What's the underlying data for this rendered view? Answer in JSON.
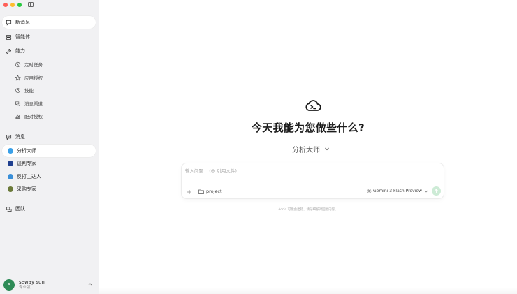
{
  "sidebar": {
    "items": [
      {
        "label": "新消息",
        "icon": "chat-bubble-icon"
      },
      {
        "label": "智能体",
        "icon": "agent-icon"
      },
      {
        "label": "能力",
        "icon": "wrench-icon"
      },
      {
        "label": "定时任务",
        "icon": "clock-icon"
      },
      {
        "label": "应用授权",
        "icon": "star-icon"
      },
      {
        "label": "技能",
        "icon": "skill-icon"
      },
      {
        "label": "消息渠道",
        "icon": "channel-icon"
      },
      {
        "label": "配对授权",
        "icon": "pairing-icon"
      },
      {
        "label": "消息",
        "icon": "message-icon"
      },
      {
        "label": "团队",
        "icon": "team-icon"
      }
    ],
    "agents": [
      {
        "label": "分析大师",
        "color": "#3aa0e8"
      },
      {
        "label": "谈判专家",
        "color": "#1f3f8f"
      },
      {
        "label": "反打工达人",
        "color": "#3a8fd8"
      },
      {
        "label": "采购专家",
        "color": "#6b7a3a"
      }
    ],
    "user": {
      "initial": "S",
      "name": "seway sun",
      "plan": "专业版"
    }
  },
  "main": {
    "headline": "今天我能为您做些什么?",
    "agent_selector": "分析大师",
    "composer": {
      "placeholder": "输入问题... (@ 引用文件)",
      "project": "project",
      "model": "Gemini 3 Flash Preview"
    },
    "disclaimer": "Accio 可能会出错，请仔细核对回复内容。"
  },
  "colors": {
    "sidebar_bg": "#f1f1f3",
    "send_button": "#cdebd6",
    "avatar": "#2e8b57"
  }
}
